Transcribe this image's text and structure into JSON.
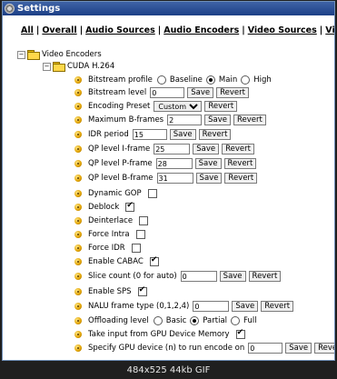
{
  "window": {
    "title": "Settings",
    "title_icon": "gear-icon"
  },
  "nav": {
    "items": [
      "All",
      "Overall",
      "Audio Sources",
      "Audio Encoders",
      "Video Sources",
      "Video Encoders"
    ],
    "separator": "|"
  },
  "tree": {
    "root": {
      "label": "Video Encoders",
      "toggle": "−"
    },
    "child": {
      "label": "CUDA H.264",
      "toggle": "−"
    }
  },
  "options": {
    "bitstream_profile": {
      "label": "Bitstream profile",
      "choices": [
        "Baseline",
        "Main",
        "High"
      ],
      "selected": "Main"
    },
    "bitstream_level": {
      "label": "Bitstream level",
      "value": "0"
    },
    "encoding_preset": {
      "label": "Encoding Preset",
      "value": "Custom"
    },
    "max_bframes": {
      "label": "Maximum B-frames",
      "value": "2"
    },
    "idr_period": {
      "label": "IDR period",
      "value": "15"
    },
    "qp_i": {
      "label": "QP level I-frame",
      "value": "25"
    },
    "qp_p": {
      "label": "QP level P-frame",
      "value": "28"
    },
    "qp_b": {
      "label": "QP level B-frame",
      "value": "31"
    },
    "dynamic_gop": {
      "label": "Dynamic GOP",
      "checked": false
    },
    "deblock": {
      "label": "Deblock",
      "checked": true
    },
    "deinterlace": {
      "label": "Deinterlace",
      "checked": false
    },
    "force_intra": {
      "label": "Force Intra",
      "checked": false
    },
    "force_idr": {
      "label": "Force IDR",
      "checked": false
    },
    "enable_cabac": {
      "label": "Enable CABAC",
      "checked": true
    },
    "slice_count": {
      "label": "Slice count (0 for auto)",
      "value": "0"
    },
    "enable_sps": {
      "label": "Enable SPS",
      "checked": true
    },
    "nalu_type": {
      "label": "NALU frame type (0,1,2,4)",
      "value": "0"
    },
    "offloading_level": {
      "label": "Offloading level",
      "choices": [
        "Basic",
        "Partial",
        "Full"
      ],
      "selected": "Partial"
    },
    "gpu_memory": {
      "label": "Take input from GPU Device Memory",
      "checked": true
    },
    "gpu_device": {
      "label": "Specify GPU device (n) to run encode on",
      "value": "0"
    }
  },
  "buttons": {
    "save": "Save",
    "revert": "Revert"
  },
  "caption": "484x525 44kb GIF"
}
